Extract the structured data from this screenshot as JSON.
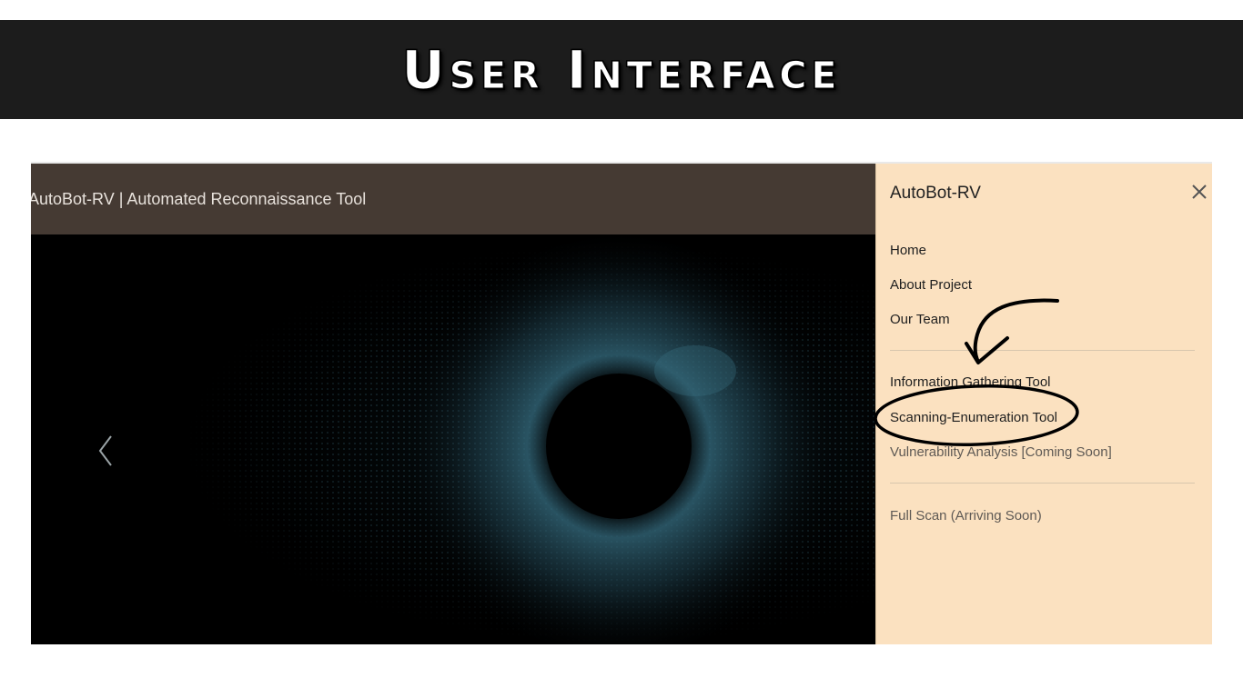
{
  "banner": {
    "title": "User Interface"
  },
  "app": {
    "header_title": "AutoBot-RV | Automated Reconnaissance Tool"
  },
  "sidebar": {
    "brand": "AutoBot-RV",
    "close_icon": "close-icon",
    "nav": [
      {
        "label": "Home"
      },
      {
        "label": "About Project"
      },
      {
        "label": "Our Team"
      }
    ],
    "tools": [
      {
        "label": "Information Gathering Tool"
      },
      {
        "label": "Scanning-Enumeration Tool"
      },
      {
        "label": "Vulnerability Analysis [Coming Soon]"
      }
    ],
    "extra": [
      {
        "label": "Full Scan (Arriving Soon)"
      }
    ]
  },
  "colors": {
    "banner_bg": "#1c1c1c",
    "header_bg": "#453a33",
    "sidebar_bg": "#fbe1c0",
    "eye_tint": "#2b5566"
  }
}
